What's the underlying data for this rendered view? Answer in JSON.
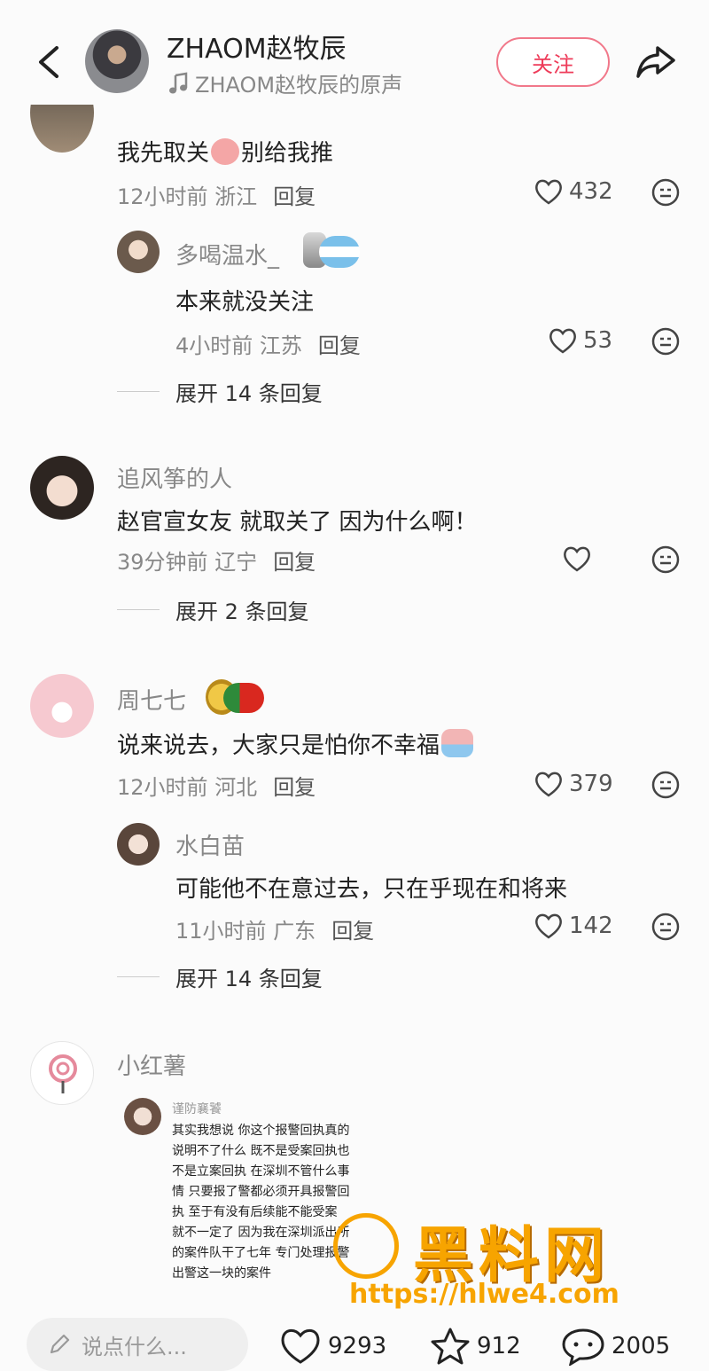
{
  "header": {
    "title": "ZHAOM赵牧辰",
    "subtitle": "ZHAOM赵牧辰的原声",
    "follow_label": "关注"
  },
  "comments": [
    {
      "text": "我先取关",
      "text_after": "别给我推",
      "meta_time": "12小时前",
      "meta_loc": "浙江",
      "reply_label": "回复",
      "likes": "432",
      "reply": {
        "user": "多喝温水_",
        "text": "本来就没关注",
        "meta_time": "4小时前",
        "meta_loc": "江苏",
        "reply_label": "回复",
        "likes": "53"
      },
      "expand": "展开 14 条回复"
    },
    {
      "user": "追风筝的人",
      "text": "赵官宣女友 就取关了 因为什么啊！",
      "meta_time": "39分钟前",
      "meta_loc": "辽宁",
      "reply_label": "回复",
      "likes": "",
      "expand": "展开 2 条回复"
    },
    {
      "user": "周七七",
      "text": "说来说去，大家只是怕你不幸福",
      "meta_time": "12小时前",
      "meta_loc": "河北",
      "reply_label": "回复",
      "likes": "379",
      "reply": {
        "user": "水白苗",
        "text": "可能他不在意过去，只在乎现在和将来",
        "meta_time": "11小时前",
        "meta_loc": "广东",
        "reply_label": "回复",
        "likes": "142"
      },
      "expand": "展开 14 条回复"
    },
    {
      "user": "小红薯",
      "image_note": {
        "user": "谨防襄饕",
        "lines": [
          "其实我想说 你这个报警回执真的",
          "说明不了什么 既不是受案回执也",
          "不是立案回执 在深圳不管什么事",
          "情 只要报了警都必须开具报警回",
          "执 至于有没有后续能不能受案",
          "就不一定了 因为我在深圳派出所",
          "的案件队干了七年 专门处理报警",
          "出警这一块的案件"
        ]
      }
    }
  ],
  "bottom": {
    "input_placeholder": "说点什么...",
    "likes": "9293",
    "favorites": "912",
    "comments": "2005"
  },
  "watermark": {
    "text": "黑料网",
    "url": "https://hlwe4.com"
  },
  "colors": {
    "accent": "#ee3b59",
    "watermark": "#f7a400"
  }
}
